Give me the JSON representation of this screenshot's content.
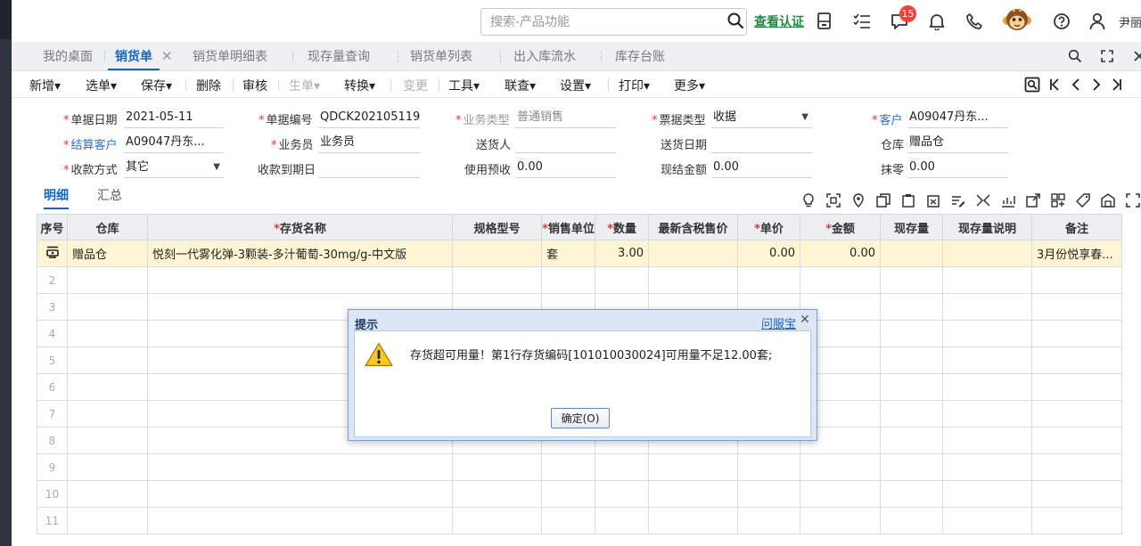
{
  "topbar": {
    "search_placeholder": "搜索-产品功能",
    "verify_link": "查看认证",
    "notification_count": "15",
    "username": "尹丽",
    "icons": [
      "search-icon",
      "document-icon",
      "checklist-icon",
      "message-icon",
      "bell-icon",
      "phone-icon",
      "monkey-avatar-icon",
      "help-icon",
      "user-icon"
    ]
  },
  "tabs": [
    {
      "label": "我的桌面",
      "active": false
    },
    {
      "label": "销货单",
      "active": true
    },
    {
      "label": "销货单明细表",
      "active": false
    },
    {
      "label": "现存量查询",
      "active": false
    },
    {
      "label": "销货单列表",
      "active": false
    },
    {
      "label": "出入库流水",
      "active": false
    },
    {
      "label": "库存台账",
      "active": false
    }
  ],
  "tab_close": "✕",
  "toolbar": {
    "new": "新增",
    "select": "选单",
    "save": "保存",
    "delete": "删除",
    "audit": "审核",
    "generate": "生单",
    "convert": "转换",
    "change": "变更",
    "tools": "工具",
    "link": "联查",
    "settings": "设置",
    "print": "打印",
    "more": "更多",
    "dropdown_mark": "▾"
  },
  "form": {
    "doc_date": {
      "label": "单据日期",
      "value": "2021-05-11"
    },
    "doc_no": {
      "label": "单据编号",
      "value": "QDCK202105119..."
    },
    "biz_type": {
      "label": "业务类型",
      "value": "普通销售"
    },
    "bill_type": {
      "label": "票据类型",
      "value": "收据"
    },
    "customer": {
      "label": "客户",
      "value": "A09047丹东..."
    },
    "settle_customer": {
      "label": "结算客户",
      "value": "A09047丹东..."
    },
    "salesman": {
      "label": "业务员",
      "value": "业务员"
    },
    "delivery_person": {
      "label": "送货人",
      "value": ""
    },
    "delivery_date": {
      "label": "送货日期",
      "value": ""
    },
    "warehouse": {
      "label": "仓库",
      "value": "赠品仓"
    },
    "pay_method": {
      "label": "收款方式",
      "value": "其它"
    },
    "due_date": {
      "label": "收款到期日",
      "value": ""
    },
    "use_prepaid": {
      "label": "使用预收",
      "value": "0.00"
    },
    "cash_amount": {
      "label": "现结金额",
      "value": "0.00"
    },
    "rounding": {
      "label": "抹零",
      "value": "0.00"
    }
  },
  "subtabs": {
    "detail": "明细",
    "summary": "汇总"
  },
  "grid": {
    "headers": [
      "序号",
      "仓库",
      "存货名称",
      "规格型号",
      "销售单位",
      "数量",
      "最新含税售价",
      "单价",
      "金额",
      "现存量",
      "现存量说明",
      "备注"
    ],
    "required": [
      false,
      false,
      true,
      false,
      true,
      true,
      false,
      true,
      true,
      false,
      false,
      false
    ],
    "rows": [
      [
        "",
        "赠品仓",
        "悦刻一代雾化弹-3颗装-多汁葡萄-30mg/g-中文版",
        "",
        "套",
        "3.00",
        "",
        "0.00",
        "0.00",
        "",
        "",
        "3月份悦享春..."
      ],
      [
        "2",
        "",
        "",
        "",
        "",
        "",
        "",
        "",
        "",
        "",
        "",
        ""
      ],
      [
        "3",
        "",
        "",
        "",
        "",
        "",
        "",
        "",
        "",
        "",
        "",
        ""
      ],
      [
        "4",
        "",
        "",
        "",
        "",
        "",
        "",
        "",
        "",
        "",
        "",
        ""
      ],
      [
        "5",
        "",
        "",
        "",
        "",
        "",
        "",
        "",
        "",
        "",
        "",
        ""
      ],
      [
        "6",
        "",
        "",
        "",
        "",
        "",
        "",
        "",
        "",
        "",
        "",
        ""
      ],
      [
        "7",
        "",
        "",
        "",
        "",
        "",
        "",
        "",
        "",
        "",
        "",
        ""
      ],
      [
        "8",
        "",
        "",
        "",
        "",
        "",
        "",
        "",
        "",
        "",
        "",
        ""
      ],
      [
        "9",
        "",
        "",
        "",
        "",
        "",
        "",
        "",
        "",
        "",
        "",
        ""
      ],
      [
        "10",
        "",
        "",
        "",
        "",
        "",
        "",
        "",
        "",
        "",
        "",
        ""
      ],
      [
        "11",
        "",
        "",
        "",
        "",
        "",
        "",
        "",
        "",
        "",
        "",
        ""
      ]
    ]
  },
  "dialog": {
    "title": "提示",
    "help_link": "问服宝",
    "close": "✕",
    "message": "存货超可用量！第1行存货编码[101010030024]可用量不足12.00套;",
    "ok_button": "确定(O)"
  }
}
